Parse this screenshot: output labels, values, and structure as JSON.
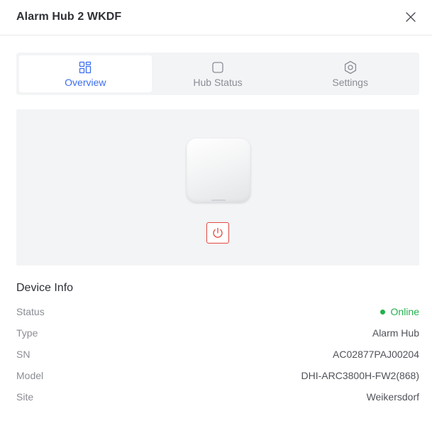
{
  "header": {
    "title": "Alarm Hub 2 WKDF",
    "close_icon": "close-icon"
  },
  "tabs": [
    {
      "label": "Overview",
      "icon": "overview-grid-icon",
      "active": true
    },
    {
      "label": "Hub Status",
      "icon": "square-icon",
      "active": false
    },
    {
      "label": "Settings",
      "icon": "gear-hex-icon",
      "active": false
    }
  ],
  "device": {
    "image": "alarm-hub-device",
    "power_icon": "power-icon"
  },
  "device_info": {
    "title": "Device Info",
    "rows": [
      {
        "label": "Status",
        "value": "Online"
      },
      {
        "label": "Type",
        "value": "Alarm Hub"
      },
      {
        "label": "SN",
        "value": "AC02877PAJ00204"
      },
      {
        "label": "Model",
        "value": "DHI-ARC3800H-FW2(868)"
      },
      {
        "label": "Site",
        "value": "Weikersdorf"
      }
    ]
  },
  "colors": {
    "accent": "#3b6df0",
    "online": "#22b14c",
    "power": "#e0483e"
  }
}
